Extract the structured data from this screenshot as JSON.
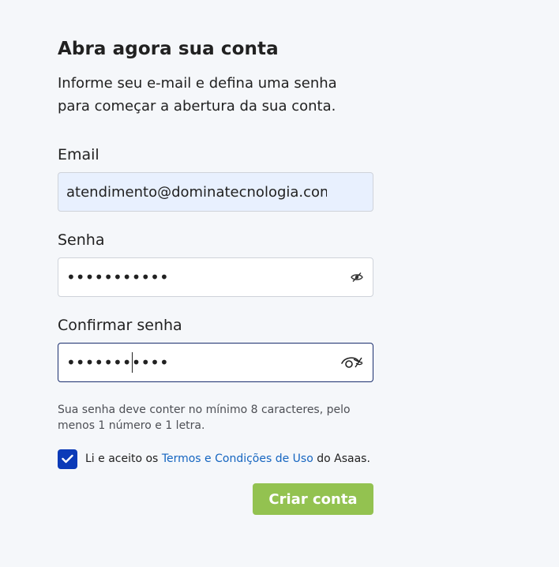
{
  "form": {
    "title": "Abra agora sua conta",
    "intro_line1": "Informe seu e-mail e defina uma senha",
    "intro_line2": "para começar a abertura da sua conta.",
    "email": {
      "label": "Email",
      "value": "atendimento@dominatecnologia.com",
      "icon": "none"
    },
    "password": {
      "label": "Senha",
      "value": "•••••••••••",
      "icon": "eye-slash-icon"
    },
    "confirm_password": {
      "label": "Confirmar senha",
      "value": "•••••••••••",
      "icon": "eye-slash-icon",
      "focused": true
    },
    "hint_line1": "Sua senha deve conter no mínimo 8 caracteres, pelo",
    "hint_line2": "menos 1 número e 1 letra.",
    "terms": {
      "checked": true,
      "prefix": "Li e aceito os",
      "link_text": "Termos e Condições de Uso",
      "suffix": "do Asaas."
    },
    "submit_label": "Criar conta"
  },
  "colors": {
    "background": "#f5f7fa",
    "autofill_background": "#e8f0fe",
    "focus_border": "#1a2e6e",
    "checkbox": "#0b3ab8",
    "link": "#1565c0",
    "submit_button": "#93c250"
  }
}
